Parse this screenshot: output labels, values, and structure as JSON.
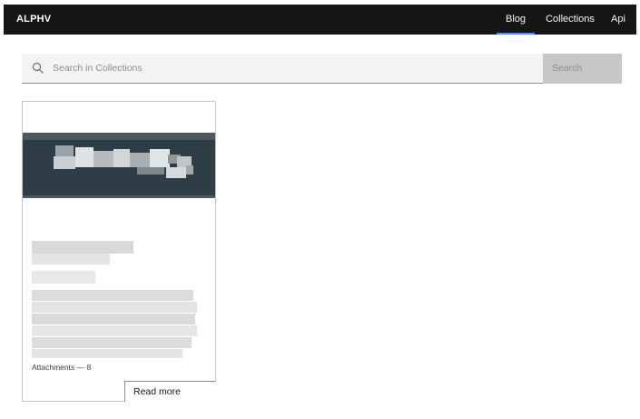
{
  "header": {
    "brand": "ALPHV",
    "nav": {
      "blog": "Blog",
      "collections": "Collections",
      "api": "Api"
    },
    "active_nav": "Blog",
    "accent_color": "#4589ff"
  },
  "search": {
    "placeholder": "Search in Collections",
    "value": "",
    "button_label": "Search",
    "icon": "search-icon"
  },
  "card": {
    "image_state": "pixelated",
    "text_state": "pixelated",
    "attachments_label": "Attachments — 8",
    "read_more_label": "Read more"
  },
  "colors": {
    "topbar": "#161616",
    "search_bg": "#f4f4f4",
    "search_button": "#c6c6c6",
    "card_image": "#2f3e46"
  }
}
